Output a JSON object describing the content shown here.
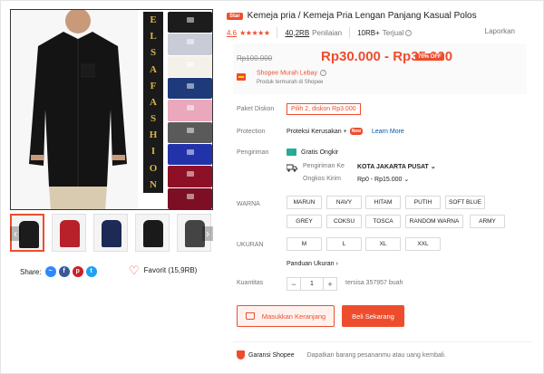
{
  "gallery": {
    "brand_letters": [
      "E",
      "L",
      "S",
      "A",
      "F",
      "A",
      "S",
      "H",
      "I",
      "O",
      "N"
    ],
    "swatch_colors": [
      "#1c1c1c",
      "#c9ccd6",
      "#f4f0ea",
      "#1e3a7a",
      "#e9a8bb",
      "#5a5a5a",
      "#2233aa",
      "#8e1026",
      "#7d0f24"
    ],
    "thumb_colors": [
      "#1c1c1c",
      "#b8202a",
      "#1c2a55",
      "#1a1a1a",
      "#444444"
    ],
    "thumb_prev": "‹",
    "thumb_next": "›"
  },
  "share": {
    "label": "Share:",
    "icons": [
      {
        "name": "messenger-icon",
        "color": "#2d88ff",
        "glyph": "~"
      },
      {
        "name": "facebook-icon",
        "color": "#3b5998",
        "glyph": "f"
      },
      {
        "name": "pinterest-icon",
        "color": "#cb2027",
        "glyph": "p"
      },
      {
        "name": "twitter-icon",
        "color": "#1da1f2",
        "glyph": "t"
      }
    ]
  },
  "favorite": {
    "label": "Favorit (15,9RB)"
  },
  "product": {
    "badge": "Star",
    "title": "Kemeja pria / Kemeja Pria Lengan Panjang Kasual Polos",
    "rating": "4.6",
    "stars": "★★★★★",
    "ratings_count": "40,2RB",
    "ratings_label": "Penilaian",
    "sold": "10RB+",
    "sold_label": "Terjual",
    "report": "Laporkan"
  },
  "price": {
    "old": "Rp100.000",
    "current": "Rp30.000 - Rp35.000",
    "discount": "70% OFF",
    "murah_label": "Shopee Murah Lebay",
    "murah_sub": "Produk termurah di Shopee"
  },
  "paket": {
    "label": "Paket Diskon",
    "value": "Pilih 2, diskon Rp3.000"
  },
  "protection": {
    "label": "Protection",
    "value": "Proteksi Kerusakan +",
    "badge": "New",
    "link": "Learn More"
  },
  "shipping": {
    "label": "Pengiriman",
    "free": "Gratis Ongkir",
    "to_label": "Pengiriman Ke",
    "city": "KOTA JAKARTA PUSAT",
    "cost_label": "Ongkos Kirim",
    "cost": "Rp0 - Rp15.000",
    "chevron": "⌄"
  },
  "colors": {
    "label": "WARNA",
    "options": [
      "MARUN",
      "NAVY",
      "HITAM",
      "PUTIH",
      "SOFT BLUE",
      "GREY",
      "COKSU",
      "TOSCA",
      "RANDOM WARNA",
      "ARMY"
    ]
  },
  "sizes": {
    "label": "UKURAN",
    "options": [
      "M",
      "L",
      "XL",
      "XXL"
    ],
    "guide": "Panduan Ukuran",
    "guide_chevron": "›"
  },
  "quantity": {
    "label": "Kuantitas",
    "minus": "−",
    "value": "1",
    "plus": "+",
    "stock": "tersisa 357957 buah"
  },
  "actions": {
    "cart": "Masukkan Keranjang",
    "buy": "Beli Sekarang"
  },
  "guarantee": {
    "title": "Garansi Shopee",
    "desc": "Dapatkan barang pesananmu atau uang kembali."
  },
  "accent": "#ee4d2d"
}
